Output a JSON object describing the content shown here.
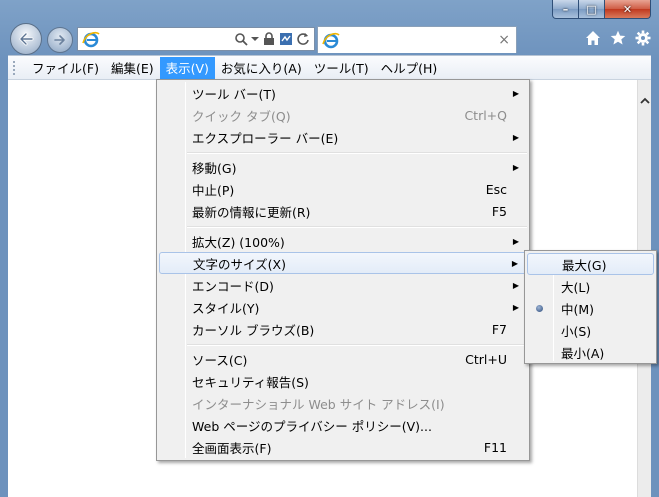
{
  "window": {
    "caption_minimize": "–",
    "caption_maximize": "□",
    "caption_close": "✕"
  },
  "address": {
    "value": "",
    "search_icon": "search-icon",
    "dropdown_icon": "chevron-down-icon",
    "lock_icon": "lock-icon",
    "refresh_icon": "refresh-icon"
  },
  "tab": {
    "title": "",
    "close": "×"
  },
  "menubar": {
    "items": [
      {
        "label": "ファイル(F)"
      },
      {
        "label": "編集(E)"
      },
      {
        "label": "表示(V)"
      },
      {
        "label": "お気に入り(A)"
      },
      {
        "label": "ツール(T)"
      },
      {
        "label": "ヘルプ(H)"
      }
    ]
  },
  "view_menu": {
    "items": [
      {
        "label": "ツール バー(T)",
        "shortcut": ""
      },
      {
        "label": "クイック タブ(Q)",
        "shortcut": "Ctrl+Q"
      },
      {
        "label": "エクスプローラー バー(E)",
        "shortcut": ""
      },
      {
        "label": "移動(G)",
        "shortcut": ""
      },
      {
        "label": "中止(P)",
        "shortcut": "Esc"
      },
      {
        "label": "最新の情報に更新(R)",
        "shortcut": "F5"
      },
      {
        "label": "拡大(Z) (100%)",
        "shortcut": ""
      },
      {
        "label": "文字のサイズ(X)",
        "shortcut": ""
      },
      {
        "label": "エンコード(D)",
        "shortcut": ""
      },
      {
        "label": "スタイル(Y)",
        "shortcut": ""
      },
      {
        "label": "カーソル ブラウズ(B)",
        "shortcut": "F7"
      },
      {
        "label": "ソース(C)",
        "shortcut": "Ctrl+U"
      },
      {
        "label": "セキュリティ報告(S)",
        "shortcut": ""
      },
      {
        "label": "インターナショナル Web サイト アドレス(I)",
        "shortcut": ""
      },
      {
        "label": "Web ページのプライバシー ポリシー(V)...",
        "shortcut": ""
      },
      {
        "label": "全画面表示(F)",
        "shortcut": "F11"
      }
    ]
  },
  "text_size_menu": {
    "items": [
      {
        "label": "最大(G)"
      },
      {
        "label": "大(L)"
      },
      {
        "label": "中(M)",
        "selected": true
      },
      {
        "label": "小(S)"
      },
      {
        "label": "最小(A)"
      }
    ]
  },
  "colors": {
    "accent": "#3399ff",
    "highlight_border": "#a9c3e8",
    "disabled_text": "#8d8d8d"
  }
}
